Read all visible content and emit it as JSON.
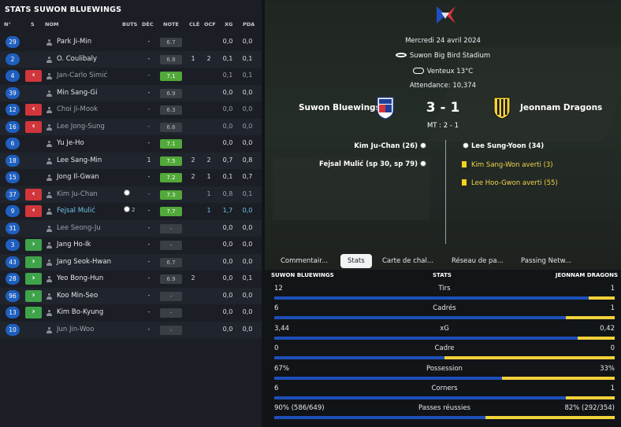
{
  "left": {
    "title": "STATS SUWON BLUEWINGS",
    "headers": {
      "num": "N°",
      "s": "S",
      "nom": "NOM",
      "buts": "BUTS",
      "dec": "DÉC",
      "note": "NOTE",
      "cle": "CLÉ",
      "ocf": "OCF",
      "xg": "XG",
      "pda": "PDA"
    },
    "players": [
      {
        "num": "29",
        "sub": "",
        "name": "Park Ji-Min",
        "buts": "",
        "dec": "-",
        "note": "6.7",
        "cle": "",
        "ocf": "",
        "xg": "0,0",
        "pda": "0,0"
      },
      {
        "num": "2",
        "sub": "",
        "name": "O. Coulibaly",
        "buts": "",
        "dec": "-",
        "note": "6.8",
        "cle": "1",
        "ocf": "2",
        "xg": "0,1",
        "pda": "0,1"
      },
      {
        "num": "4",
        "sub": "<",
        "name": "Jan-Carlo Simić",
        "buts": "",
        "dec": "-",
        "note": "7.1",
        "cle": "",
        "ocf": "",
        "xg": "0,1",
        "pda": "0,1"
      },
      {
        "num": "39",
        "sub": "",
        "name": "Min Sang-Gi",
        "buts": "",
        "dec": "-",
        "note": "6.9",
        "cle": "",
        "ocf": "",
        "xg": "0,0",
        "pda": "0,0"
      },
      {
        "num": "12",
        "sub": "<",
        "name": "Choi Ji-Mook",
        "buts": "",
        "dec": "-",
        "note": "6.3",
        "cle": "",
        "ocf": "",
        "xg": "0,0",
        "pda": "0,0"
      },
      {
        "num": "16",
        "sub": "<",
        "name": "Lee Jong-Sung",
        "buts": "",
        "dec": "-",
        "note": "6.6",
        "cle": "",
        "ocf": "",
        "xg": "0,0",
        "pda": "0,0"
      },
      {
        "num": "6",
        "sub": "",
        "name": "Yu Je-Ho",
        "buts": "",
        "dec": "-",
        "note": "7.1",
        "cle": "",
        "ocf": "",
        "xg": "0,0",
        "pda": "0,0"
      },
      {
        "num": "18",
        "sub": "",
        "name": "Lee Sang-Min",
        "buts": "",
        "dec": "1",
        "note": "7.5",
        "cle": "2",
        "ocf": "2",
        "xg": "0,7",
        "pda": "0,8"
      },
      {
        "num": "15",
        "sub": "",
        "name": "Jong Il-Gwan",
        "buts": "",
        "dec": "-",
        "note": "7.2",
        "cle": "2",
        "ocf": "1",
        "xg": "0,1",
        "pda": "0,7"
      },
      {
        "num": "37",
        "sub": "<",
        "name": "Kim Ju-Chan",
        "buts": "ball",
        "butsn": "",
        "dec": "-",
        "note": "7.3",
        "cle": "",
        "ocf": "1",
        "xg": "0,8",
        "pda": "0,1"
      },
      {
        "num": "9",
        "sub": "<",
        "name": "Fejsal Mulić",
        "buts": "ball",
        "butsn": "2",
        "dec": "-",
        "note": "7.7",
        "cle": "",
        "ocf": "1",
        "xg": "1,7",
        "pda": "0,0"
      },
      {
        "num": "31",
        "sub": "",
        "name": "Lee Seong-Ju",
        "buts": "",
        "dec": "-",
        "note": "-",
        "cle": "",
        "ocf": "",
        "xg": "0,0",
        "pda": "0,0"
      },
      {
        "num": "3",
        "sub": ">",
        "name": "Jang Ho-Ik",
        "buts": "",
        "dec": "-",
        "note": "-",
        "cle": "",
        "ocf": "",
        "xg": "0,0",
        "pda": "0,0"
      },
      {
        "num": "43",
        "sub": ">",
        "name": "Jang Seok-Hwan",
        "buts": "",
        "dec": "-",
        "note": "6.7",
        "cle": "",
        "ocf": "",
        "xg": "0,0",
        "pda": "0,0"
      },
      {
        "num": "28",
        "sub": ">",
        "name": "Yeo Bong-Hun",
        "buts": "",
        "dec": "-",
        "note": "6.9",
        "cle": "2",
        "ocf": "",
        "xg": "0,0",
        "pda": "0,1"
      },
      {
        "num": "96",
        "sub": ">",
        "name": "Koo Min-Seo",
        "buts": "",
        "dec": "-",
        "note": "-",
        "cle": "",
        "ocf": "",
        "xg": "0,0",
        "pda": "0,0"
      },
      {
        "num": "13",
        "sub": ">",
        "name": "Kim Bo-Kyung",
        "buts": "",
        "dec": "-",
        "note": "-",
        "cle": "",
        "ocf": "",
        "xg": "0,0",
        "pda": "0,0"
      },
      {
        "num": "10",
        "sub": "",
        "name": "Jun Jin-Woo",
        "buts": "",
        "dec": "-",
        "note": "-",
        "cle": "",
        "ocf": "",
        "xg": "0,0",
        "pda": "0,0"
      }
    ]
  },
  "match": {
    "date": "Mercredi 24 avril 2024",
    "stadium": "Suwon Big Bird Stadium",
    "weather": "Venteux 13°C",
    "attendance": "Attendance: 10,374",
    "home": "Suwon Bluewings",
    "away": "Jeonnam Dragons",
    "score": "3 - 1",
    "halftime": "MT : 2 - 1",
    "home_events": [
      "Kim Ju-Chan (26)",
      "Fejsal Mulić (sp 30, sp 79)"
    ],
    "away_events": [
      {
        "text": "Lee Sung-Yoon (34)",
        "type": "goal"
      },
      {
        "text": "Kim Sang-Won averti (3)",
        "type": "card"
      },
      {
        "text": "Lee Hoo-Gwon averti (55)",
        "type": "card"
      }
    ]
  },
  "tabs": [
    "Commentair...",
    "Stats",
    "Carte de chal...",
    "Réseau de pa...",
    "Passing Netw..."
  ],
  "active_tab": 1,
  "stats": {
    "home_label": "SUWON BLUEWINGS",
    "title": "STATS",
    "away_label": "JEONNAM DRAGONS",
    "rows": [
      {
        "label": "Tirs",
        "home": "12",
        "away": "1",
        "share": 0.923
      },
      {
        "label": "Cadrés",
        "home": "6",
        "away": "1",
        "share": 0.857
      },
      {
        "label": "xG",
        "home": "3,44",
        "away": "0,42",
        "share": 0.891
      },
      {
        "label": "Cadre",
        "home": "0",
        "away": "0",
        "share": 0.5
      },
      {
        "label": "Possession",
        "home": "67%",
        "away": "33%",
        "share": 0.67
      },
      {
        "label": "Corners",
        "home": "6",
        "away": "1",
        "share": 0.857
      },
      {
        "label": "Passes réussies",
        "home": "90% (586/649)",
        "away": "82% (292/354)",
        "share": 0.62
      }
    ]
  },
  "colors": {
    "home": "#1d4fb8",
    "away": "#f2d13a",
    "good_rating": "#52a83a",
    "sub_out": "#d0363b",
    "sub_in": "#3ea34a"
  }
}
